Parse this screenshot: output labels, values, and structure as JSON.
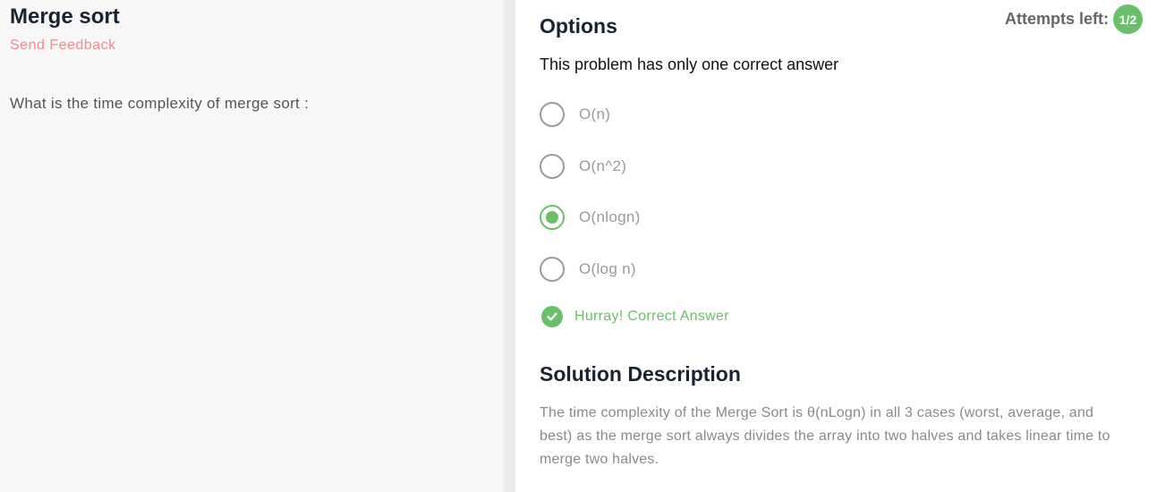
{
  "problem": {
    "title": "Merge sort",
    "feedback_label": "Send Feedback",
    "question": "What is the time complexity of merge sort :"
  },
  "options_panel": {
    "heading": "Options",
    "attempts_label": "Attempts left:",
    "attempts_value": "1/2",
    "instruction": "This problem has only one correct answer",
    "options": [
      {
        "label": "O(n)",
        "selected": false
      },
      {
        "label": "O(n^2)",
        "selected": false
      },
      {
        "label": "O(nlogn)",
        "selected": true
      },
      {
        "label": "O(log n)",
        "selected": false
      }
    ],
    "result_text": "Hurray! Correct Answer"
  },
  "solution": {
    "heading": "Solution Description",
    "text": "The time complexity of the Merge Sort is θ(nLogn) in all 3 cases (worst, average, and best) as the merge sort always divides the array into two halves and takes linear time to merge two halves."
  },
  "colors": {
    "accent_green": "#6abf69",
    "feedback_pink": "#f28b8b",
    "heading_dark": "#1a2332"
  },
  "icons": {
    "result": "check-circle-icon"
  }
}
